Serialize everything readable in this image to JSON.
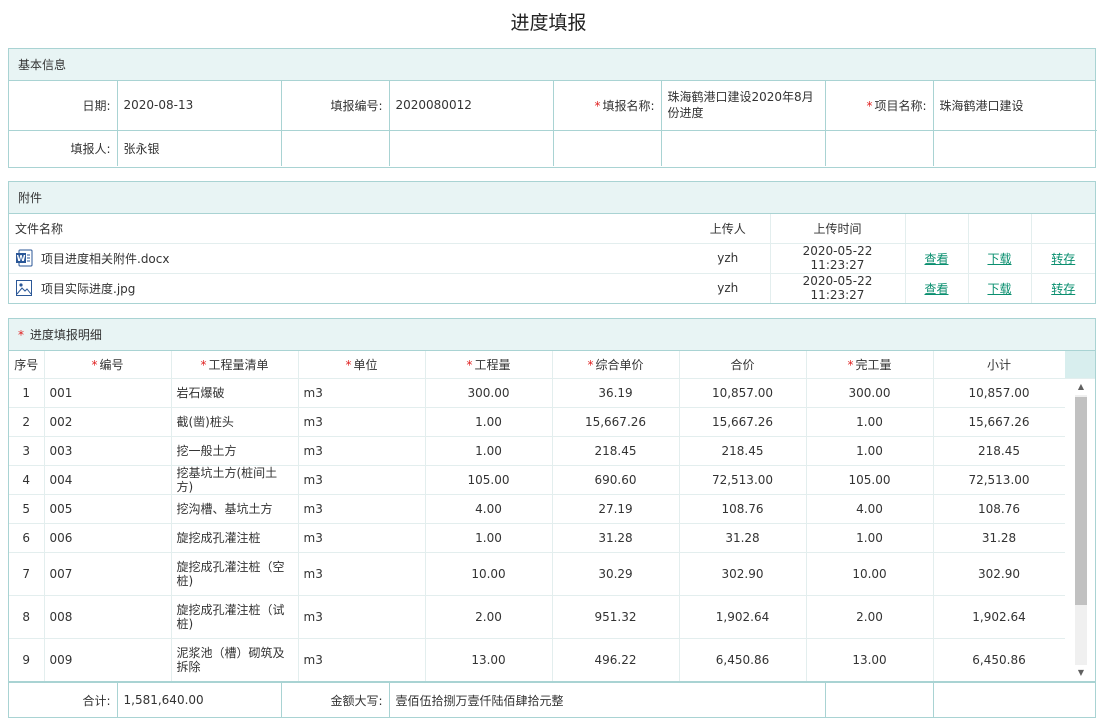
{
  "page": {
    "title": "进度填报"
  },
  "basic": {
    "section_title": "基本信息",
    "date_label": "日期:",
    "date_value": "2020-08-13",
    "code_label": "填报编号:",
    "code_value": "2020080012",
    "report_name_label": "填报名称:",
    "report_name_value": "珠海鹤港口建设2020年8月份进度",
    "project_name_label": "项目名称:",
    "project_name_value": "珠海鹤港口建设",
    "reporter_label": "填报人:",
    "reporter_value": "张永银"
  },
  "attachments": {
    "section_title": "附件",
    "headers": {
      "file": "文件名称",
      "uploader": "上传人",
      "time": "上传时间"
    },
    "rows": [
      {
        "name": "项目进度相关附件.docx",
        "icon": "word-doc-icon",
        "uploader": "yzh",
        "time": "2020-05-22 11:23:27",
        "view": "查看",
        "download": "下载",
        "save": "转存"
      },
      {
        "name": "项目实际进度.jpg",
        "icon": "image-file-icon",
        "uploader": "yzh",
        "time": "2020-05-22 11:23:27",
        "view": "查看",
        "download": "下载",
        "save": "转存"
      }
    ]
  },
  "detail": {
    "section_title": "进度填报明细",
    "headers": [
      "序号",
      "编号",
      "工程量清单",
      "单位",
      "工程量",
      "综合单价",
      "合价",
      "完工量",
      "小计"
    ],
    "rows": [
      {
        "idx": "1",
        "code": "001",
        "item": "岩石爆破",
        "unit": "m3",
        "qty": "300.00",
        "price": "36.19",
        "total": "10,857.00",
        "done": "300.00",
        "subtotal": "10,857.00"
      },
      {
        "idx": "2",
        "code": "002",
        "item": "截(凿)桩头",
        "unit": "m3",
        "qty": "1.00",
        "price": "15,667.26",
        "total": "15,667.26",
        "done": "1.00",
        "subtotal": "15,667.26"
      },
      {
        "idx": "3",
        "code": "003",
        "item": "挖一般土方",
        "unit": "m3",
        "qty": "1.00",
        "price": "218.45",
        "total": "218.45",
        "done": "1.00",
        "subtotal": "218.45"
      },
      {
        "idx": "4",
        "code": "004",
        "item": "挖基坑土方(桩间土方)",
        "unit": "m3",
        "qty": "105.00",
        "price": "690.60",
        "total": "72,513.00",
        "done": "105.00",
        "subtotal": "72,513.00"
      },
      {
        "idx": "5",
        "code": "005",
        "item": "挖沟槽、基坑土方",
        "unit": "m3",
        "qty": "4.00",
        "price": "27.19",
        "total": "108.76",
        "done": "4.00",
        "subtotal": "108.76"
      },
      {
        "idx": "6",
        "code": "006",
        "item": "旋挖成孔灌注桩",
        "unit": "m3",
        "qty": "1.00",
        "price": "31.28",
        "total": "31.28",
        "done": "1.00",
        "subtotal": "31.28"
      },
      {
        "idx": "7",
        "code": "007",
        "item": "旋挖成孔灌注桩（空桩)",
        "unit": "m3",
        "qty": "10.00",
        "price": "30.29",
        "total": "302.90",
        "done": "10.00",
        "subtotal": "302.90"
      },
      {
        "idx": "8",
        "code": "008",
        "item": "旋挖成孔灌注桩（试桩)",
        "unit": "m3",
        "qty": "2.00",
        "price": "951.32",
        "total": "1,902.64",
        "done": "2.00",
        "subtotal": "1,902.64"
      },
      {
        "idx": "9",
        "code": "009",
        "item": "泥浆池（槽）砌筑及拆除",
        "unit": "m3",
        "qty": "13.00",
        "price": "496.22",
        "total": "6,450.86",
        "done": "13.00",
        "subtotal": "6,450.86"
      }
    ]
  },
  "summary": {
    "total_label": "合计:",
    "total_value": "1,581,640.00",
    "caps_label": "金额大写:",
    "caps_value": "壹佰伍拾捌万壹仟陆佰肆拾元整"
  },
  "colors": {
    "border": "#a9d3d3",
    "header_bg": "#e8f4f4",
    "link": "#0a8f6f",
    "required": "#e02020"
  }
}
